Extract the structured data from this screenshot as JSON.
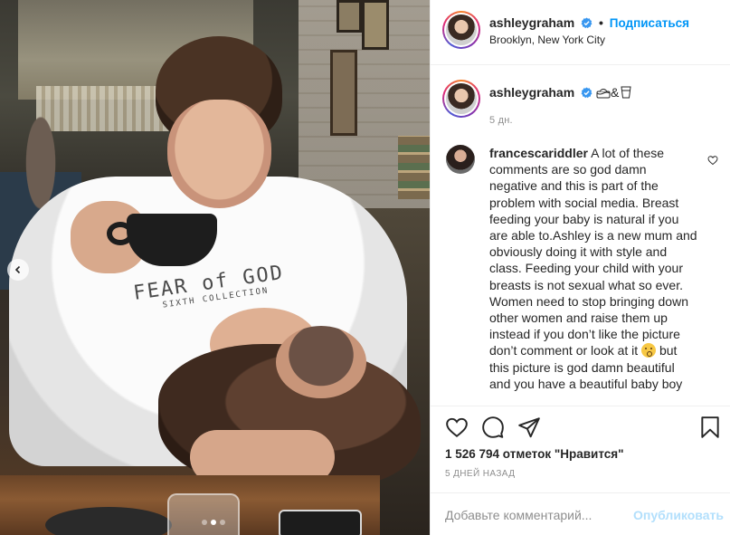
{
  "post": {
    "username": "ashleygraham",
    "follow_label": "Подписаться",
    "separator": "•",
    "location": "Brooklyn, New York City"
  },
  "caption": {
    "username": "ashleygraham",
    "text_emoji": "&",
    "time": "5 дн."
  },
  "comment": {
    "username": "francescariddler",
    "text_part1": "A lot of these comments are so god damn negative and this is part of the problem with social media. Breast feeding your baby is natural if you are able to.Ashley is a new mum and obviously doing it with style and class. Feeding your child with your breasts is not sexual what so ever. Women need to stop bringing down other women and raise them up instead if you don’t like the picture don’t comment or look at it",
    "text_part2": "but this picture is god damn beautiful and you have a beautiful baby boy"
  },
  "actions": {
    "likes": "1 526 794 отметок \"Нравится\"",
    "date": "5 ДНЕЙ НАЗАД"
  },
  "add_comment": {
    "placeholder": "Добавьте комментарий...",
    "post_label": "Опубликовать"
  },
  "photo": {
    "sweater_text_1": "FEAR of GOD",
    "sweater_text_2": "SIXTH COLLECTION",
    "carousel_dots": 3,
    "active_dot": 2
  },
  "colors": {
    "link": "#0095f6",
    "post_disabled": "#b2dffc",
    "muted": "#8e8e8e",
    "text": "#262626",
    "verified": "#3897f0"
  }
}
